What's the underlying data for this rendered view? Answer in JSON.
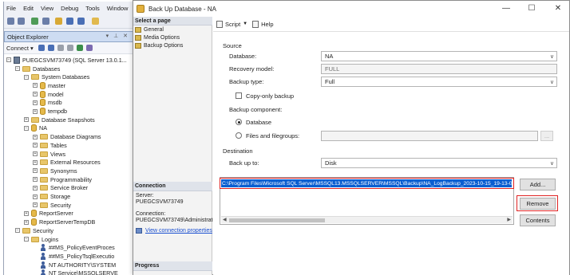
{
  "ssms": {
    "menu": [
      "File",
      "Edit",
      "View",
      "Debug",
      "Tools",
      "Window"
    ],
    "object_explorer": {
      "title": "Object Explorer",
      "pin_icons": "▾ ⊥ ✕",
      "connect_label": "Connect ▾",
      "tree": [
        {
          "label": "PUEGCSVM73749 (SQL Server 13.0.1...",
          "icon": "server-icon",
          "exp": "⊟",
          "indent": 0
        },
        {
          "label": "Databases",
          "icon": "folder-icon",
          "exp": "⊟",
          "indent": 1
        },
        {
          "label": "System Databases",
          "icon": "folder-icon",
          "exp": "⊟",
          "indent": 2
        },
        {
          "label": "master",
          "icon": "database-icon",
          "exp": "⊞",
          "indent": 3
        },
        {
          "label": "model",
          "icon": "database-icon",
          "exp": "⊞",
          "indent": 3
        },
        {
          "label": "msdb",
          "icon": "database-icon",
          "exp": "⊞",
          "indent": 3
        },
        {
          "label": "tempdb",
          "icon": "database-icon",
          "exp": "⊞",
          "indent": 3
        },
        {
          "label": "Database Snapshots",
          "icon": "folder-icon",
          "exp": "⊞",
          "indent": 2
        },
        {
          "label": "NA",
          "icon": "database-icon",
          "exp": "⊟",
          "indent": 2
        },
        {
          "label": "Database Diagrams",
          "icon": "folder-icon",
          "exp": "⊞",
          "indent": 3
        },
        {
          "label": "Tables",
          "icon": "folder-icon",
          "exp": "⊞",
          "indent": 3
        },
        {
          "label": "Views",
          "icon": "folder-icon",
          "exp": "⊞",
          "indent": 3
        },
        {
          "label": "External Resources",
          "icon": "folder-icon",
          "exp": "⊞",
          "indent": 3
        },
        {
          "label": "Synonyms",
          "icon": "folder-icon",
          "exp": "⊞",
          "indent": 3
        },
        {
          "label": "Programmability",
          "icon": "folder-icon",
          "exp": "⊞",
          "indent": 3
        },
        {
          "label": "Service Broker",
          "icon": "folder-icon",
          "exp": "⊞",
          "indent": 3
        },
        {
          "label": "Storage",
          "icon": "folder-icon",
          "exp": "⊞",
          "indent": 3
        },
        {
          "label": "Security",
          "icon": "folder-icon",
          "exp": "⊞",
          "indent": 3
        },
        {
          "label": "ReportServer",
          "icon": "database-icon",
          "exp": "⊞",
          "indent": 2
        },
        {
          "label": "ReportServerTempDB",
          "icon": "database-icon",
          "exp": "⊞",
          "indent": 2
        },
        {
          "label": "Security",
          "icon": "folder-icon",
          "exp": "⊟",
          "indent": 1
        },
        {
          "label": "Logins",
          "icon": "folder-icon",
          "exp": "⊟",
          "indent": 2
        },
        {
          "label": "##MS_PolicyEventProces",
          "icon": "user-icon",
          "exp": "",
          "indent": 3
        },
        {
          "label": "##MS_PolicyTsqlExecutio",
          "icon": "user-icon",
          "exp": "",
          "indent": 3
        },
        {
          "label": "NT AUTHORITY\\SYSTEM",
          "icon": "user-icon",
          "exp": "",
          "indent": 3
        },
        {
          "label": "NT Service\\MSSQLSERVE",
          "icon": "user-icon",
          "exp": "",
          "indent": 3
        }
      ]
    }
  },
  "dialog": {
    "title": "Back Up Database - NA",
    "window_buttons": {
      "minimize": "—",
      "maximize": "☐",
      "close": "✕"
    },
    "left": {
      "select_page_header": "Select a page",
      "pages": [
        "General",
        "Media Options",
        "Backup Options"
      ],
      "connection_header": "Connection",
      "server_label": "Server:",
      "server_value": "PUEGCSVM73749",
      "connection_label": "Connection:",
      "connection_value": "PUEGCSVM73749\\Administrator",
      "view_link": "View connection properties",
      "progress_header": "Progress"
    },
    "toolbar": {
      "script": "Script",
      "help": "Help"
    },
    "source": {
      "section": "Source",
      "database_label": "Database:",
      "database_value": "NA",
      "recovery_label": "Recovery model:",
      "recovery_value": "FULL",
      "backup_type_label": "Backup type:",
      "backup_type_value": "Full",
      "copy_only_label": "Copy-only backup",
      "component_label": "Backup component:",
      "radio_database": "Database",
      "radio_files": "Files and filegroups:",
      "files_button": "..."
    },
    "destination": {
      "section": "Destination",
      "backup_to_label": "Back up to:",
      "backup_to_value": "Disk",
      "path": "C:\\Program Files\\Microsoft SQL Server\\MSSQL13.MSSQLSERVER\\MSSQL\\Backup\\NA_LogBackup_2023-10-15_19-13-09.bak",
      "add_button": "Add...",
      "remove_button": "Remove",
      "contents_button": "Contents"
    },
    "highlight_color": "#e02424",
    "selection_color": "#0b5fd1"
  }
}
